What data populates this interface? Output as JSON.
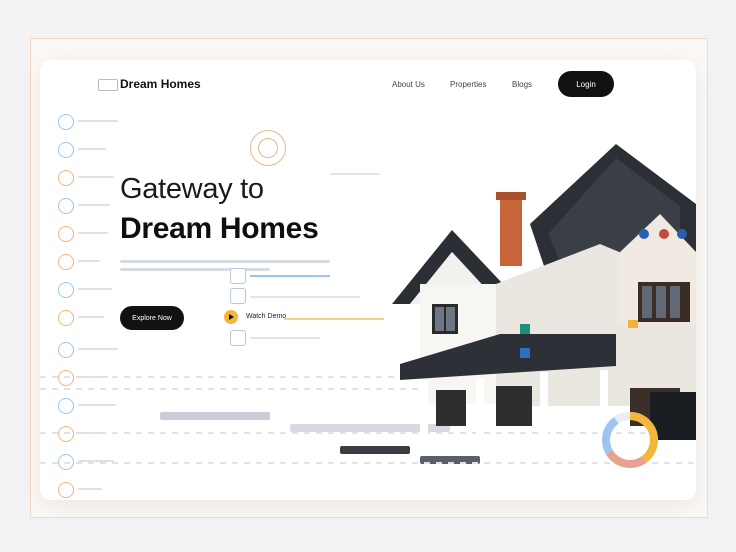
{
  "header": {
    "brand": "Dream Homes",
    "nav_links": [
      "About Us",
      "Properties",
      "Blogs"
    ],
    "login_label": "Login"
  },
  "hero": {
    "title_line1": "Gateway to",
    "title_line2": "Dream Homes",
    "cta_label": "Explore Now",
    "watch_label": "Watch Demo"
  },
  "colors": {
    "accent_orange": "#f4b73a",
    "wire_blue": "#9dc6ee",
    "wire_peach": "#e2b98d",
    "primary_dark": "#111111"
  },
  "icons": [
    "logo-icon",
    "play-icon",
    "house-image",
    "donut-chart"
  ]
}
